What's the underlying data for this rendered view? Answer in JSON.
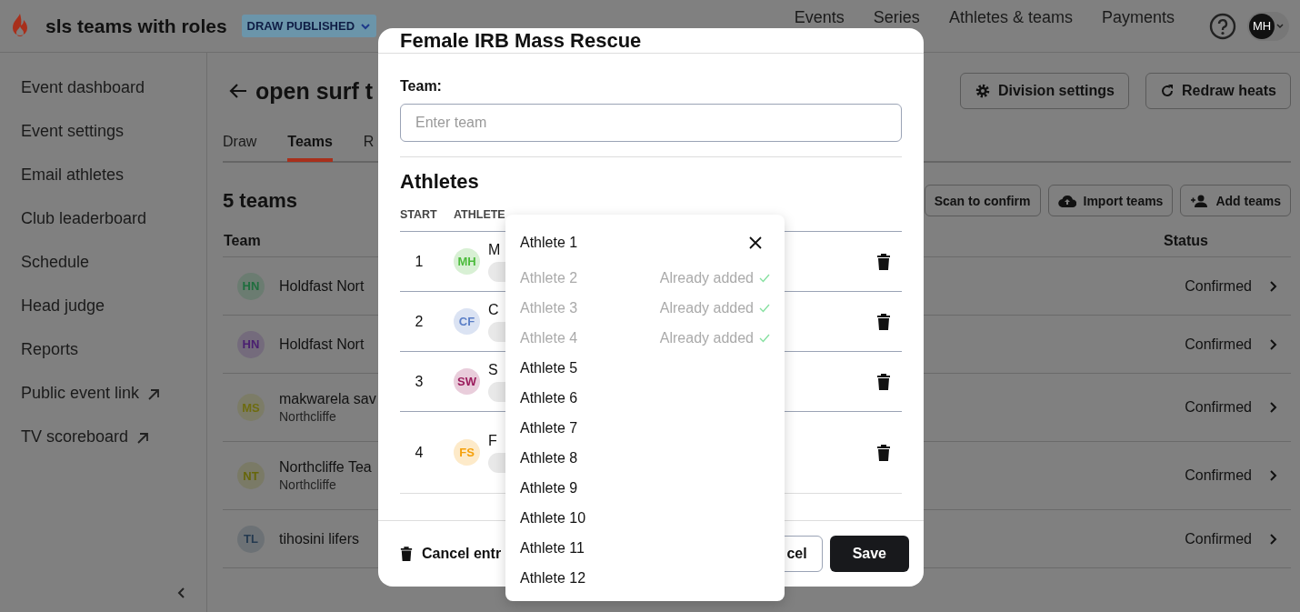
{
  "app": {
    "title": "sls teams with roles",
    "status_badge": "DRAW PUBLISHED"
  },
  "nav": [
    "Events",
    "Series",
    "Athletes & teams",
    "Payments"
  ],
  "user": {
    "initials": "MH"
  },
  "sidebar": {
    "items": [
      {
        "label": "Event dashboard",
        "external": false
      },
      {
        "label": "Event settings",
        "external": false
      },
      {
        "label": "Email athletes",
        "external": false
      },
      {
        "label": "Club leaderboard",
        "external": false
      },
      {
        "label": "Schedule",
        "external": false
      },
      {
        "label": "Head judge",
        "external": false
      },
      {
        "label": "Reports",
        "external": false
      },
      {
        "label": "Public event link",
        "external": true
      },
      {
        "label": "TV scoreboard",
        "external": true
      }
    ]
  },
  "page": {
    "title": "open surf t",
    "actions": [
      {
        "label": "Division settings",
        "kind": "settings"
      },
      {
        "label": "Redraw heats",
        "kind": "redraw"
      }
    ]
  },
  "tabs": [
    {
      "label": "Draw",
      "selected": false
    },
    {
      "label": "Teams",
      "selected": true
    },
    {
      "label": "R",
      "selected": false
    }
  ],
  "teams": {
    "count_label": "5 teams",
    "actions": [
      {
        "label": "Scan to confirm",
        "kind": "plain"
      },
      {
        "label": "Import teams",
        "kind": "upload"
      },
      {
        "label": "Add teams",
        "kind": "add-person"
      }
    ],
    "columns": [
      "Team",
      "Status"
    ],
    "rows": [
      {
        "initials": "HN",
        "color": "#1f6e3e",
        "name": "Holdfast Nort",
        "status": "Confirmed"
      },
      {
        "initials": "HN",
        "color": "#4a1f70",
        "name": "Holdfast Nort",
        "status": "Confirmed"
      },
      {
        "initials": "MS",
        "color": "#6e6c10",
        "name": "makwarela sav",
        "club": "Northcliffe",
        "status": "Confirmed"
      },
      {
        "initials": "NT",
        "color": "#66660a",
        "name": "Northcliffe Tea",
        "club": "Northcliffe",
        "status": "Confirmed"
      },
      {
        "initials": "TL",
        "color": "#243a50",
        "name": "tihosini lifers",
        "status": "Confirmed"
      }
    ]
  },
  "modal": {
    "title": "Female IRB Mass Rescue",
    "team_label": "Team:",
    "team_placeholder": "Enter team",
    "athletes_heading": "Athletes",
    "columns": [
      "START",
      "ATHLETE"
    ],
    "rows": [
      {
        "start": "1",
        "initials": "MH",
        "color": "#4cbb3c",
        "name": "M"
      },
      {
        "start": "2",
        "initials": "CF",
        "color": "#5b7fc7",
        "name": "C"
      },
      {
        "start": "3",
        "initials": "SW",
        "color": "#9b1c5c",
        "name": "S"
      },
      {
        "start": "4",
        "initials": "FS",
        "color": "#f5a00b",
        "name": "F"
      }
    ],
    "cancel_entry": "Cancel entr",
    "cancel": "cel",
    "save": "Save"
  },
  "dropdown": {
    "value": "Athlete 1",
    "options": [
      {
        "label": "Athlete 2",
        "disabled": true,
        "note": "Already added"
      },
      {
        "label": "Athlete 3",
        "disabled": true,
        "note": "Already added"
      },
      {
        "label": "Athlete 4",
        "disabled": true,
        "note": "Already added"
      },
      {
        "label": "Athlete 5",
        "disabled": false
      },
      {
        "label": "Athlete 6",
        "disabled": false
      },
      {
        "label": "Athlete 7",
        "disabled": false
      },
      {
        "label": "Athlete 8",
        "disabled": false
      },
      {
        "label": "Athlete 9",
        "disabled": false
      },
      {
        "label": "Athlete 10",
        "disabled": false
      },
      {
        "label": "Athlete 11",
        "disabled": false
      },
      {
        "label": "Athlete 12",
        "disabled": false
      }
    ]
  }
}
